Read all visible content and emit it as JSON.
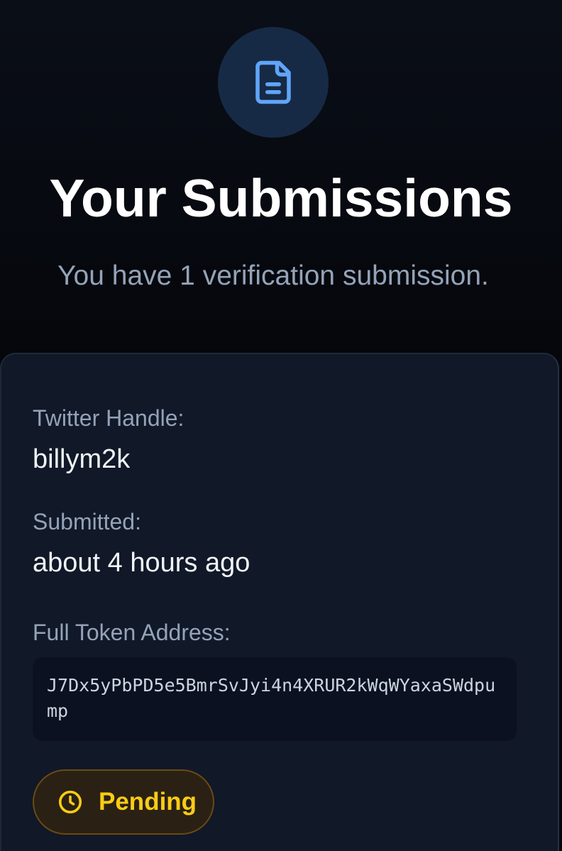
{
  "header": {
    "icon": "document-icon",
    "title": "Your Submissions",
    "subtitle": "You have 1 verification submission."
  },
  "submission": {
    "twitter_label": "Twitter Handle:",
    "twitter_value": "billym2k",
    "submitted_label": "Submitted:",
    "submitted_value": "about 4 hours ago",
    "token_label": "Full Token Address:",
    "token_value": "J7Dx5yPbPD5e5BmrSvJyi4n4XRUR2kWqWYaxaSWdpump",
    "status_icon": "clock-icon",
    "status": "Pending"
  },
  "colors": {
    "accent": "#60a5fa",
    "pending": "#facc15",
    "card_bg": "#111827"
  }
}
